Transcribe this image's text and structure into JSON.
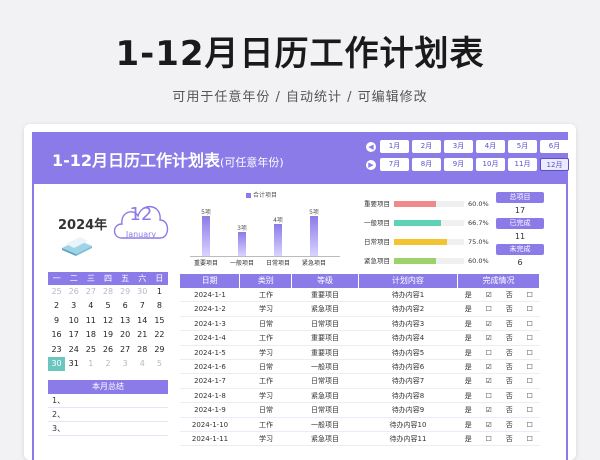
{
  "hero": {
    "title": "1-12月日历工作计划表",
    "subtitle": "可用于任意年份 / 自动统计 / 可编辑修改"
  },
  "sheet": {
    "title": "1-12月日历工作计划表",
    "title_suffix": "(可任意年份)"
  },
  "months": [
    "1月",
    "2月",
    "3月",
    "4月",
    "5月",
    "6月",
    "7月",
    "8月",
    "9月",
    "10月",
    "11月",
    "12月"
  ],
  "active_month": "12月",
  "year_label": "2024年",
  "selected_day": "12",
  "selected_month_en": "January",
  "calendar": {
    "weekdays": [
      "一",
      "二",
      "三",
      "四",
      "五",
      "六",
      "日"
    ],
    "weeks": [
      [
        {
          "d": "25",
          "dim": true
        },
        {
          "d": "26",
          "dim": true
        },
        {
          "d": "27",
          "dim": true
        },
        {
          "d": "28",
          "dim": true
        },
        {
          "d": "29",
          "dim": true
        },
        {
          "d": "30",
          "dim": true
        },
        {
          "d": "1"
        }
      ],
      [
        {
          "d": "2"
        },
        {
          "d": "3"
        },
        {
          "d": "4"
        },
        {
          "d": "5"
        },
        {
          "d": "6"
        },
        {
          "d": "7"
        },
        {
          "d": "8"
        }
      ],
      [
        {
          "d": "9"
        },
        {
          "d": "10"
        },
        {
          "d": "11"
        },
        {
          "d": "12"
        },
        {
          "d": "13"
        },
        {
          "d": "14"
        },
        {
          "d": "15"
        }
      ],
      [
        {
          "d": "16"
        },
        {
          "d": "17"
        },
        {
          "d": "18"
        },
        {
          "d": "19"
        },
        {
          "d": "20"
        },
        {
          "d": "21"
        },
        {
          "d": "22"
        }
      ],
      [
        {
          "d": "23"
        },
        {
          "d": "24"
        },
        {
          "d": "25"
        },
        {
          "d": "26"
        },
        {
          "d": "27"
        },
        {
          "d": "28"
        },
        {
          "d": "29"
        }
      ],
      [
        {
          "d": "30",
          "today": true
        },
        {
          "d": "31"
        },
        {
          "d": "1",
          "dim": true
        },
        {
          "d": "2",
          "dim": true
        },
        {
          "d": "3",
          "dim": true
        },
        {
          "d": "4",
          "dim": true
        },
        {
          "d": "5",
          "dim": true
        }
      ]
    ]
  },
  "summary": {
    "title": "本月总结",
    "lines": [
      "1、",
      "2、",
      "3、"
    ]
  },
  "chart_data": {
    "type": "bar",
    "legend": "合计项目",
    "categories": [
      "重要项目",
      "一般项目",
      "日常项目",
      "紧急项目"
    ],
    "values": [
      5,
      3,
      4,
      5
    ],
    "value_labels": [
      "5项",
      "3项",
      "4项",
      "5项"
    ]
  },
  "progress": [
    {
      "label": "重要项目",
      "value": 60.0,
      "display": "60.0%",
      "color": "#f08a8a"
    },
    {
      "label": "一般项目",
      "value": 66.7,
      "display": "66.7%",
      "color": "#5fd1b5"
    },
    {
      "label": "日常项目",
      "value": 75.0,
      "display": "75.0%",
      "color": "#f4c430"
    },
    {
      "label": "紧急项目",
      "value": 60.0,
      "display": "60.0%",
      "color": "#9bd26a"
    }
  ],
  "stats": [
    {
      "label": "总项目",
      "value": "17"
    },
    {
      "label": "已完成",
      "value": "11"
    },
    {
      "label": "未完成",
      "value": "6"
    }
  ],
  "table": {
    "headers": [
      "日期",
      "类别",
      "等级",
      "计划内容",
      "完成情况"
    ],
    "rows": [
      [
        "2024-1-1",
        "工作",
        "重要项目",
        "待办内容1",
        "是",
        "☑",
        "否",
        "☐"
      ],
      [
        "2024-1-2",
        "学习",
        "紧急项目",
        "待办内容2",
        "是",
        "☐",
        "否",
        "☐"
      ],
      [
        "2024-1-3",
        "日常",
        "日常项目",
        "待办内容3",
        "是",
        "☑",
        "否",
        "☐"
      ],
      [
        "2024-1-4",
        "工作",
        "重要项目",
        "待办内容4",
        "是",
        "☑",
        "否",
        "☐"
      ],
      [
        "2024-1-5",
        "学习",
        "重要项目",
        "待办内容5",
        "是",
        "☐",
        "否",
        "☐"
      ],
      [
        "2024-1-6",
        "日常",
        "一般项目",
        "待办内容6",
        "是",
        "☑",
        "否",
        "☐"
      ],
      [
        "2024-1-7",
        "工作",
        "日常项目",
        "待办内容7",
        "是",
        "☑",
        "否",
        "☐"
      ],
      [
        "2024-1-8",
        "学习",
        "紧急项目",
        "待办内容8",
        "是",
        "☐",
        "否",
        "☐"
      ],
      [
        "2024-1-9",
        "日常",
        "日常项目",
        "待办内容9",
        "是",
        "☑",
        "否",
        "☐"
      ],
      [
        "2024-1-10",
        "工作",
        "一般项目",
        "待办内容10",
        "是",
        "☑",
        "否",
        "☐"
      ],
      [
        "2024-1-11",
        "学习",
        "紧急项目",
        "待办内容11",
        "是",
        "☐",
        "否",
        "☐"
      ]
    ]
  }
}
